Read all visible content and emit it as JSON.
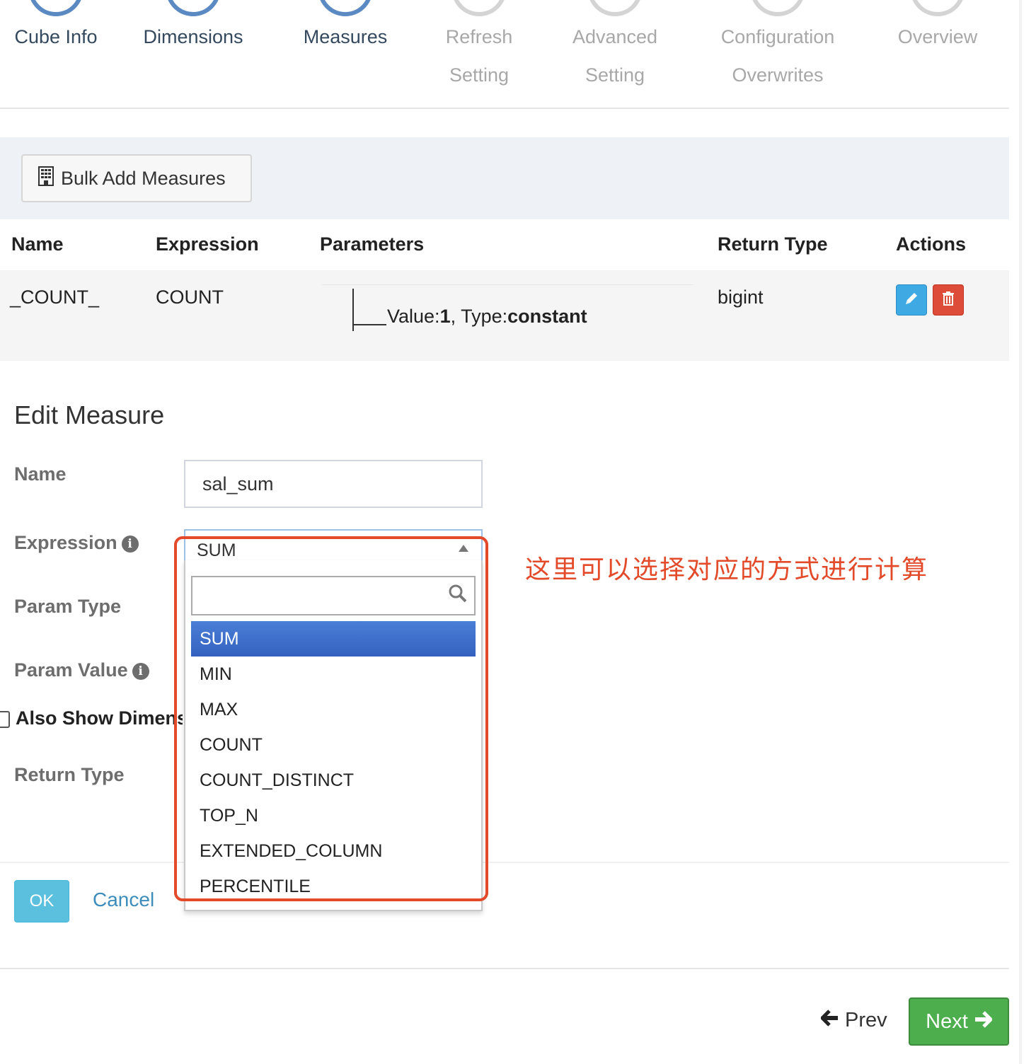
{
  "wizard": {
    "steps": [
      {
        "label": "Cube Info",
        "label2": ""
      },
      {
        "label": "Dimensions",
        "label2": ""
      },
      {
        "label": "Measures",
        "label2": ""
      },
      {
        "label": "Refresh",
        "label2": "Setting"
      },
      {
        "label": "Advanced",
        "label2": "Setting"
      },
      {
        "label": "Configuration",
        "label2": "Overwrites"
      },
      {
        "label": "Overview",
        "label2": ""
      }
    ]
  },
  "toolbar": {
    "bulk_add_label": "Bulk Add Measures"
  },
  "table": {
    "headers": {
      "name": "Name",
      "expression": "Expression",
      "parameters": "Parameters",
      "return_type": "Return Type",
      "actions": "Actions"
    },
    "rows": [
      {
        "name": "_COUNT_",
        "expression": "COUNT",
        "param_value_label": "Value:",
        "param_value": "1",
        "param_sep": ", ",
        "param_type_label": "Type:",
        "param_type": "constant",
        "return_type": "bigint"
      }
    ]
  },
  "edit_measure": {
    "title": "Edit Measure",
    "labels": {
      "name": "Name",
      "expression": "Expression",
      "param_type": "Param Type",
      "param_value": "Param Value",
      "also_show": "Also Show Dimensions",
      "return_type": "Return Type"
    },
    "name_value": "sal_sum",
    "expression_selected": "SUM",
    "search_value": "",
    "expression_options": [
      "SUM",
      "MIN",
      "MAX",
      "COUNT",
      "COUNT_DISTINCT",
      "TOP_N",
      "EXTENDED_COLUMN",
      "PERCENTILE"
    ],
    "ok_label": "OK",
    "cancel_label": "Cancel"
  },
  "annotation": "这里可以选择对应的方式进行计算",
  "nav": {
    "prev_label": "Prev",
    "next_label": "Next"
  },
  "colors": {
    "step_active": "#5b8ac2",
    "step_inactive": "#d4d4d4",
    "annotation_red": "#e24a2a",
    "selected_option": "#3b6cc8",
    "next_green": "#4cae4c",
    "ok_cyan": "#5bc0de"
  },
  "icons": {
    "bulk_add": "building-icon",
    "edit": "pencil-icon",
    "delete": "trash-icon",
    "info": "info-circle-icon",
    "search": "search-icon",
    "prev": "arrow-left-icon",
    "next": "arrow-right-icon"
  }
}
